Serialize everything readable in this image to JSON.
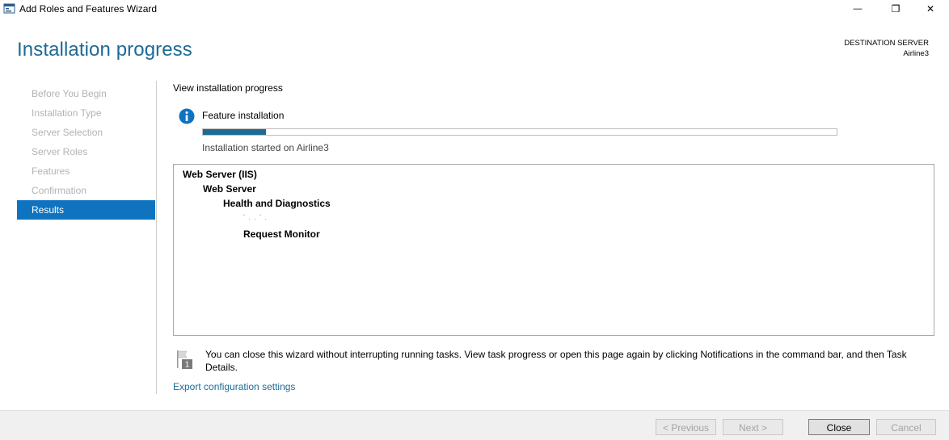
{
  "window": {
    "title": "Add Roles and Features Wizard",
    "minimize_symbol": "—",
    "maximize_symbol": "❐",
    "close_symbol": "✕"
  },
  "header": {
    "page_title": "Installation progress",
    "destination_label": "DESTINATION SERVER",
    "destination_name": "Airline3"
  },
  "nav": {
    "items": [
      {
        "label": "Before You Begin"
      },
      {
        "label": "Installation Type"
      },
      {
        "label": "Server Selection"
      },
      {
        "label": "Server Roles"
      },
      {
        "label": "Features"
      },
      {
        "label": "Confirmation"
      },
      {
        "label": "Results"
      }
    ],
    "active_index": 6
  },
  "content": {
    "section_title": "View installation progress",
    "feature_label": "Feature installation",
    "progress_fraction": 0.1,
    "install_started": "Installation started on Airline3",
    "results": {
      "level1": "Web Server (IIS)",
      "level2": "Web Server",
      "level3": "Health and Diagnostics",
      "level4_partial": "' . . ' .",
      "level5": "Request Monitor"
    },
    "note": "You can close this wizard without interrupting running tasks. View task progress or open this page again by clicking Notifications in the command bar, and then Task Details.",
    "flag_badge": "1",
    "export_link": "Export configuration settings"
  },
  "footer": {
    "previous": "< Previous",
    "next": "Next >",
    "close": "Close",
    "cancel": "Cancel"
  },
  "colors": {
    "accent": "#1d6b94",
    "nav_active": "#0f73c0"
  },
  "icons": {
    "app": "server-manager-icon",
    "info": "info-icon",
    "flag": "notification-flag-icon"
  }
}
